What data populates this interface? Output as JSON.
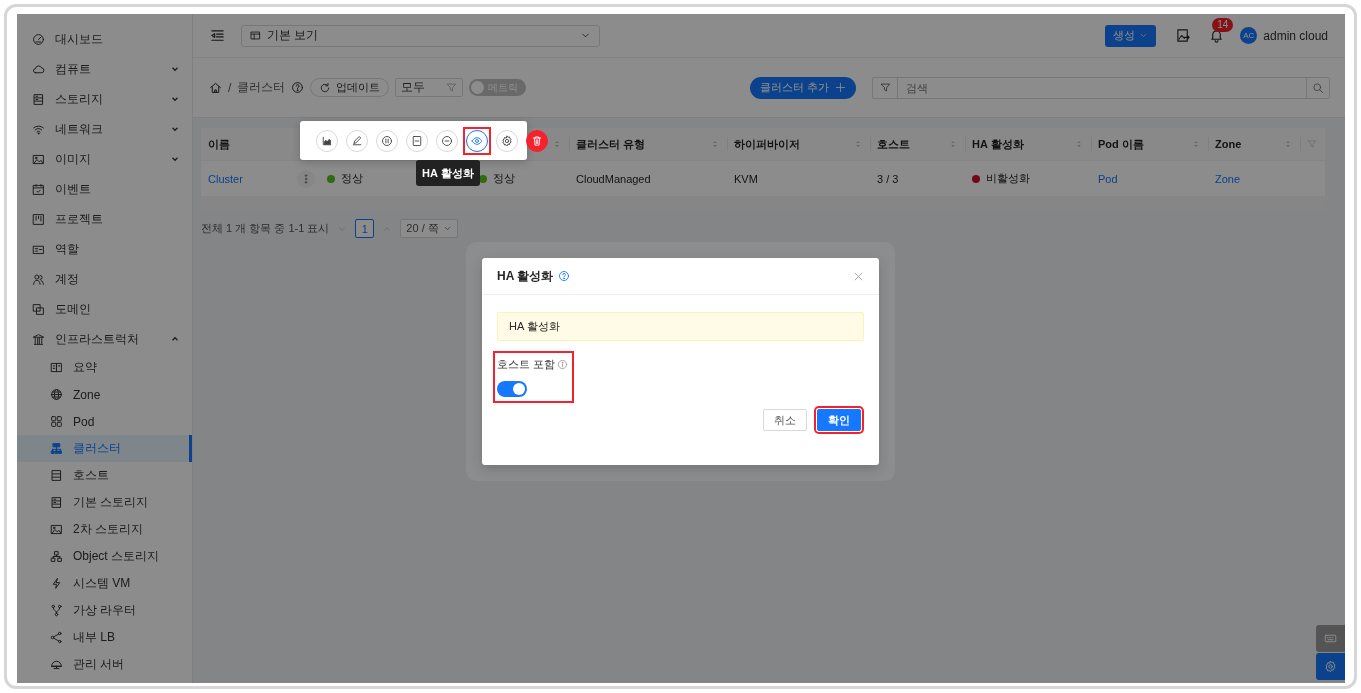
{
  "sidebar": {
    "items": [
      {
        "label": "대시보드",
        "kind": "link",
        "selected": false
      },
      {
        "label": "컴퓨트",
        "kind": "group",
        "expanded": false,
        "selected": false
      },
      {
        "label": "스토리지",
        "kind": "group",
        "expanded": false,
        "selected": false
      },
      {
        "label": "네트워크",
        "kind": "group",
        "expanded": false,
        "selected": false
      },
      {
        "label": "이미지",
        "kind": "group",
        "expanded": false,
        "selected": false
      },
      {
        "label": "이벤트",
        "kind": "link",
        "selected": false
      },
      {
        "label": "프로젝트",
        "kind": "link",
        "selected": false
      },
      {
        "label": "역할",
        "kind": "link",
        "selected": false
      },
      {
        "label": "계정",
        "kind": "link",
        "selected": false
      },
      {
        "label": "도메인",
        "kind": "link",
        "selected": false
      },
      {
        "label": "인프라스트럭처",
        "kind": "group",
        "expanded": true,
        "selected": false,
        "children": [
          {
            "label": "요약",
            "selected": false
          },
          {
            "label": "Zone",
            "selected": false
          },
          {
            "label": "Pod",
            "selected": false
          },
          {
            "label": "클러스터",
            "selected": true
          },
          {
            "label": "호스트",
            "selected": false
          },
          {
            "label": "기본 스토리지",
            "selected": false
          },
          {
            "label": "2차 스토리지",
            "selected": false
          },
          {
            "label": "Object 스토리지",
            "selected": false
          },
          {
            "label": "시스템 VM",
            "selected": false
          },
          {
            "label": "가상 라우터",
            "selected": false
          },
          {
            "label": "내부 LB",
            "selected": false
          },
          {
            "label": "관리 서버",
            "selected": false
          }
        ]
      }
    ]
  },
  "topbar": {
    "view_select": {
      "value": "기본 보기"
    },
    "create_button": "생성",
    "notifications": {
      "badge": "14"
    },
    "user": {
      "initials": "AC",
      "name": "admin cloud"
    }
  },
  "page_header": {
    "breadcrumb": {
      "separator": "/",
      "current": "클러스터"
    },
    "update_button": "업데이트",
    "filter_select": {
      "value": "모두"
    },
    "metrics_toggle": {
      "label": "메트릭",
      "on": false
    },
    "add_button": "클러스터 추가",
    "search": {
      "placeholder": "검색"
    }
  },
  "table": {
    "columns": [
      {
        "label": "이름"
      },
      {},
      {},
      {
        "label": "클러스터 유형"
      },
      {
        "label": "하이퍼바이저"
      },
      {
        "label": "호스트"
      },
      {
        "label": "HA 활성화"
      },
      {
        "label": "Pod 이름"
      },
      {
        "label": "Zone"
      }
    ],
    "rows": [
      {
        "cells": [
          {
            "kind": "name",
            "text": "Cluster"
          },
          {
            "kind": "ok",
            "text": "정상"
          },
          {
            "kind": "ok",
            "text": "정상"
          },
          {
            "kind": "text",
            "text": "CloudManaged"
          },
          {
            "kind": "text",
            "text": "KVM"
          },
          {
            "kind": "text",
            "text": "3 / 3"
          },
          {
            "kind": "error",
            "text": "비활성화"
          },
          {
            "kind": "link",
            "text": "Pod"
          },
          {
            "kind": "link",
            "text": "Zone"
          }
        ]
      }
    ]
  },
  "pagination": {
    "summary": "전체 1 개 항목 중 1-1 표시",
    "pages": [
      {
        "label": "1",
        "selected": true
      }
    ],
    "page_size": "20 / 쪽"
  },
  "row_actions": {
    "items": [
      {
        "kind": "normal",
        "selected": false,
        "highlighted": false
      },
      {
        "kind": "normal",
        "selected": false,
        "highlighted": false
      },
      {
        "kind": "normal",
        "selected": false,
        "highlighted": false
      },
      {
        "kind": "normal",
        "selected": false,
        "highlighted": false
      },
      {
        "kind": "normal",
        "selected": false,
        "highlighted": false
      },
      {
        "kind": "normal",
        "selected": true,
        "highlighted": true
      },
      {
        "kind": "normal",
        "selected": false,
        "highlighted": false
      },
      {
        "kind": "danger",
        "selected": false,
        "highlighted": false
      }
    ],
    "tooltip": "HA 활성화"
  },
  "dialog": {
    "title": "HA 활성화",
    "alert": "HA 활성화",
    "field": {
      "label": "호스트 포함",
      "on": true,
      "highlighted": true
    },
    "buttons": [
      {
        "label": "취소",
        "kind": "default",
        "highlighted": false
      },
      {
        "label": "확인",
        "kind": "primary",
        "highlighted": true
      }
    ]
  }
}
